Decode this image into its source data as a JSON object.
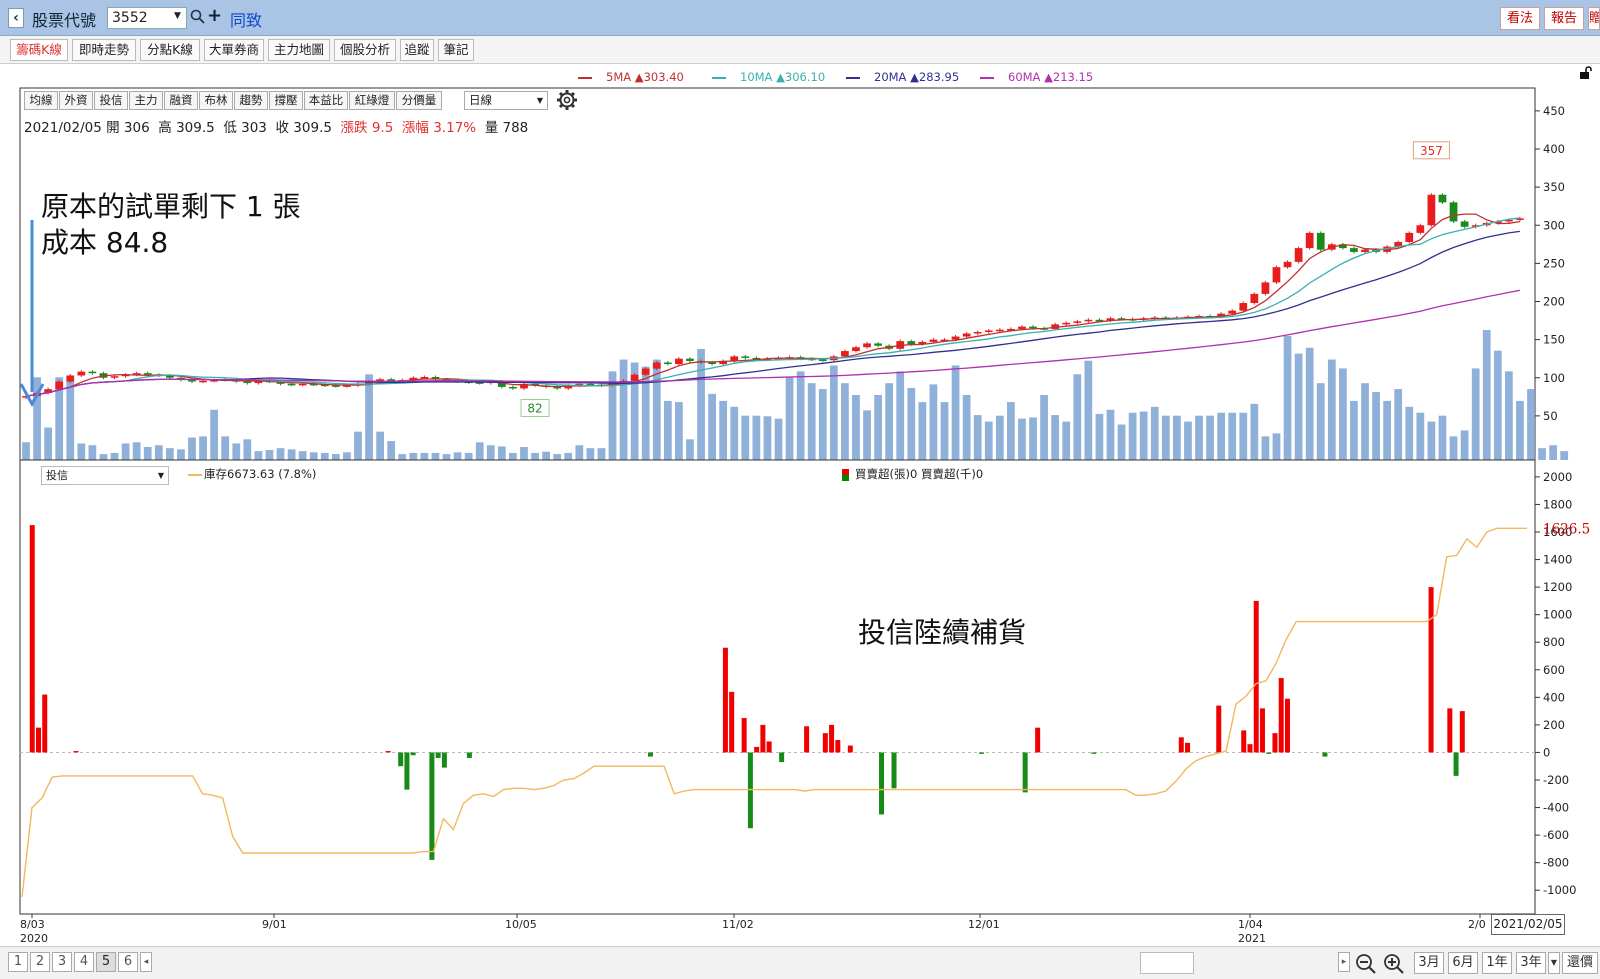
{
  "header": {
    "label": "股票代號",
    "code": "3552",
    "name": "同致",
    "buttons": [
      "看法",
      "報告",
      "贈"
    ]
  },
  "tabs": [
    "籌碼K線",
    "即時走勢",
    "分點K線",
    "大單券商",
    "主力地圖",
    "個股分析",
    "追蹤",
    "筆記"
  ],
  "ma_legend": [
    {
      "label": "5MA ▲303.40",
      "color": "#c03030"
    },
    {
      "label": "10MA ▲306.10",
      "color": "#3ab0b0"
    },
    {
      "label": "20MA ▲283.95",
      "color": "#303090"
    },
    {
      "label": "60MA ▲213.15",
      "color": "#b030b0"
    }
  ],
  "toolbar": {
    "buttons": [
      "均線",
      "外資",
      "投信",
      "主力",
      "融資",
      "布林",
      "趨勢",
      "撐壓",
      "本益比",
      "紅綠燈",
      "分價量"
    ],
    "period": "日線"
  },
  "info": {
    "date": "2021/02/05",
    "open_label": "開",
    "open": "306",
    "high_label": "高",
    "high": "309.5",
    "low_label": "低",
    "low": "303",
    "close_label": "收",
    "close": "309.5",
    "chg_label": "漲跌",
    "chg": "9.5",
    "pct_label": "漲幅",
    "pct": "3.17%",
    "vol_label": "量",
    "vol": "788"
  },
  "annotations": {
    "note1_line1": "原本的試單剩下 1 張",
    "note1_line2": "成本 84.8",
    "note2": "投信陸續補貨"
  },
  "lower": {
    "select": "投信",
    "inventory": "庫存6673.63 (7.8%)",
    "net_label": "買賣超(張)0 買賣超(千)0",
    "current_value": "1626.5"
  },
  "chart_data": [
    {
      "type": "candlestick",
      "title": "",
      "y_ticks": [
        50,
        100,
        150,
        200,
        250,
        300,
        350,
        400,
        450
      ],
      "ylim": [
        0,
        480
      ],
      "peak_label": "357",
      "low_label": "82",
      "close_series": [
        76,
        80,
        85,
        95,
        103,
        108,
        106,
        100,
        102,
        104,
        106,
        104,
        103,
        100,
        97,
        95,
        96,
        97,
        98,
        95,
        93,
        96,
        95,
        92,
        91,
        92,
        91,
        90,
        89,
        90,
        92,
        95,
        98,
        96,
        97,
        100,
        101,
        98,
        97,
        95,
        94,
        93,
        95,
        88,
        86,
        92,
        90,
        88,
        86,
        90,
        92,
        91,
        90,
        93,
        96,
        104,
        112,
        120,
        118,
        125,
        122,
        120,
        118,
        122,
        128,
        126,
        124,
        125,
        126,
        127,
        125,
        124,
        123,
        128,
        135,
        140,
        145,
        142,
        138,
        148,
        144,
        147,
        150,
        150,
        154,
        158,
        160,
        162,
        163,
        164,
        167,
        165,
        164,
        170,
        172,
        174,
        176,
        175,
        178,
        177,
        176,
        178,
        179,
        178,
        179,
        180,
        181,
        180,
        184,
        188,
        198,
        210,
        225,
        245,
        252,
        270,
        290,
        268,
        275,
        270,
        265,
        268,
        265,
        272,
        278,
        290,
        300,
        340,
        330,
        305,
        298,
        300,
        303,
        305,
        307,
        309
      ],
      "volume_series": [
        30,
        140,
        55,
        140,
        135,
        28,
        25,
        10,
        12,
        28,
        30,
        22,
        25,
        20,
        18,
        38,
        40,
        85,
        40,
        28,
        35,
        15,
        17,
        20,
        18,
        15,
        13,
        12,
        10,
        13,
        48,
        145,
        48,
        32,
        10,
        12,
        12,
        12,
        10,
        13,
        12,
        30,
        25,
        23,
        12,
        22,
        12,
        14,
        10,
        12,
        25,
        20,
        20,
        150,
        170,
        165,
        158,
        170,
        100,
        98,
        35,
        188,
        112,
        100,
        90,
        75,
        75,
        74,
        70,
        140,
        150,
        130,
        120,
        160,
        130,
        110,
        84,
        110,
        130,
        150,
        122,
        98,
        128,
        98,
        160,
        110,
        76,
        65,
        75,
        98,
        70,
        72,
        110,
        76,
        65,
        145,
        168,
        78,
        85,
        60,
        80,
        82,
        90,
        75,
        75,
        65,
        75,
        75,
        80,
        80,
        80,
        95,
        40,
        45,
        210,
        180,
        190,
        130,
        170,
        155,
        100,
        130,
        115,
        100,
        120,
        90,
        80,
        65,
        75,
        40,
        50,
        155,
        220,
        185,
        150,
        100,
        120,
        20,
        25,
        15
      ]
    },
    {
      "type": "bar",
      "title": "",
      "y_ticks": [
        -1000,
        -800,
        -600,
        -400,
        -200,
        0,
        200,
        400,
        600,
        800,
        1000,
        1200,
        1400,
        1600,
        1800,
        2000
      ],
      "ylim": [
        -1100,
        2050
      ],
      "x_tick_labels": [
        "8/03",
        "9/01",
        "10/05",
        "11/02",
        "12/01",
        "1/04",
        "2/0"
      ],
      "x_year_labels": [
        "2020",
        "2021"
      ],
      "net_series": [
        0,
        1650,
        180,
        420,
        0,
        0,
        0,
        0,
        10,
        0,
        0,
        0,
        0,
        0,
        0,
        0,
        0,
        0,
        0,
        0,
        0,
        0,
        0,
        0,
        0,
        0,
        0,
        0,
        0,
        0,
        0,
        0,
        0,
        0,
        0,
        0,
        0,
        0,
        0,
        0,
        0,
        0,
        0,
        0,
        0,
        0,
        0,
        0,
        0,
        0,
        0,
        0,
        0,
        0,
        0,
        0,
        0,
        0,
        10,
        0,
        -100,
        -270,
        -20,
        0,
        0,
        -780,
        -40,
        -110,
        0,
        0,
        0,
        -40,
        0,
        0,
        0,
        0,
        0,
        0,
        0,
        0,
        0,
        0,
        0,
        0,
        0,
        0,
        0,
        0,
        0,
        0,
        0,
        0,
        0,
        0,
        0,
        0,
        0,
        0,
        0,
        0,
        -30,
        0,
        0,
        0,
        0,
        0,
        0,
        0,
        0,
        0,
        0,
        0,
        760,
        440,
        0,
        250,
        -550,
        40,
        200,
        80,
        0,
        -70,
        0,
        0,
        0,
        190,
        0,
        0,
        140,
        200,
        90,
        0,
        50,
        0,
        0,
        0,
        0,
        -450,
        0,
        -260,
        0,
        0,
        0,
        0,
        0,
        0,
        0,
        0,
        0,
        0,
        0,
        0,
        0,
        -10,
        0,
        0,
        0,
        0,
        0,
        0,
        -290,
        0,
        180,
        0,
        0,
        0,
        0,
        0,
        0,
        0,
        0,
        -10,
        0,
        0,
        0,
        0,
        0,
        0,
        0,
        0,
        0,
        0,
        0,
        0,
        0,
        110,
        70,
        0,
        0,
        0,
        0,
        340,
        0,
        0,
        0,
        160,
        60,
        1100,
        320,
        -10,
        140,
        540,
        390,
        0,
        0,
        0,
        0,
        0,
        -30,
        0,
        0,
        0,
        0,
        0,
        0,
        0,
        0,
        0,
        0,
        0,
        0,
        0,
        0,
        0,
        0,
        1200,
        0,
        0,
        320,
        -170,
        300,
        0,
        0,
        0,
        0,
        0,
        0,
        0,
        0,
        0,
        0
      ],
      "cumulative_series": [
        -1050,
        -400,
        -330,
        -180,
        -170,
        -170,
        -170,
        -170,
        -170,
        -170,
        -170,
        -170,
        -170,
        -170,
        -170,
        -170,
        -170,
        -170,
        -300,
        -310,
        -330,
        -610,
        -730,
        -730,
        -730,
        -730,
        -730,
        -730,
        -730,
        -730,
        -730,
        -730,
        -730,
        -730,
        -730,
        -730,
        -730,
        -730,
        -730,
        -730,
        -720,
        -720,
        -480,
        -560,
        -370,
        -310,
        -300,
        -320,
        -270,
        -260,
        -260,
        -270,
        -260,
        -240,
        -200,
        -190,
        -150,
        -100,
        -100,
        -100,
        -100,
        -100,
        -100,
        -100,
        -100,
        -300,
        -280,
        -270,
        -270,
        -270,
        -270,
        -270,
        -270,
        -270,
        -270,
        -270,
        -270,
        -270,
        -280,
        -270,
        -270,
        -270,
        -270,
        -270,
        -270,
        -270,
        -270,
        -270,
        -270,
        -270,
        -270,
        -270,
        -270,
        -270,
        -270,
        -270,
        -270,
        -270,
        -270,
        -270,
        -270,
        -270,
        -270,
        -270,
        -270,
        -270,
        -270,
        -270,
        -270,
        -270,
        -270,
        -310,
        -310,
        -300,
        -280,
        -210,
        -120,
        -60,
        -30,
        -10,
        10,
        350,
        410,
        500,
        520,
        650,
        820,
        950,
        950,
        950,
        950,
        950,
        950,
        950,
        950,
        950,
        950,
        950,
        950,
        950,
        950,
        1000,
        1420,
        1430,
        1550,
        1490,
        1600,
        1626.5,
        1626.5,
        1626.5,
        1626.5
      ]
    }
  ],
  "bottom": {
    "pages": [
      "1",
      "2",
      "3",
      "4",
      "5",
      "6"
    ],
    "active_page": "5",
    "ranges": [
      "3月",
      "6月",
      "1年",
      "3年"
    ],
    "price_btn": "還價",
    "date_readout": "2021/02/05"
  }
}
